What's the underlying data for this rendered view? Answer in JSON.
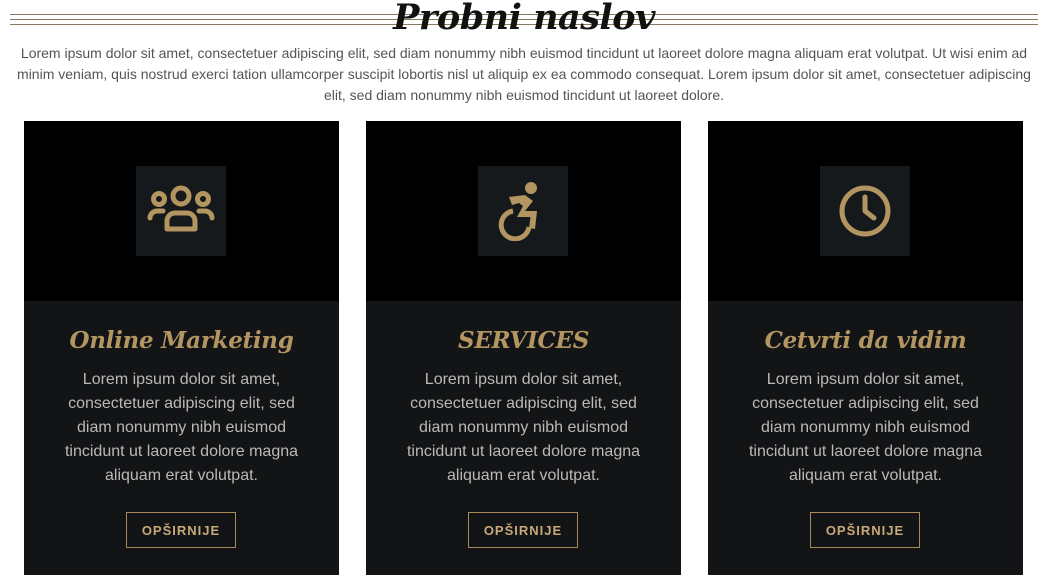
{
  "section": {
    "title": "Probni naslov",
    "intro": "Lorem ipsum dolor sit amet, consectetuer adipiscing elit, sed diam nonummy nibh euismod tincidunt ut laoreet dolore magna aliquam erat volutpat. Ut wisi enim ad minim veniam, quis nostrud exerci tation ullamcorper suscipit lobortis nisl ut aliquip ex ea commodo consequat. Lorem ipsum dolor sit amet, consectetuer adipiscing elit, sed diam nonummy nibh euismod tincidunt ut laoreet dolore."
  },
  "cards": [
    {
      "icon": "users-group-icon",
      "title": "Online Marketing",
      "text": "Lorem ipsum dolor sit amet, consectetuer adipiscing elit, sed diam nonummy nibh euismod tincidunt ut laoreet dolore magna aliquam erat volutpat.",
      "button_label": "OPŠIRNIJE"
    },
    {
      "icon": "accessible-wheelchair-icon",
      "title": "SERVICES",
      "text": "Lorem ipsum dolor sit amet, consectetuer adipiscing elit, sed diam nonummy nibh euismod tincidunt ut laoreet dolore magna aliquam erat volutpat.",
      "button_label": "OPŠIRNIJE"
    },
    {
      "icon": "clock-icon",
      "title": "Cetvrti da vidim",
      "text": "Lorem ipsum dolor sit amet, consectetuer adipiscing elit, sed diam nonummy nibh euismod tincidunt ut laoreet dolore magna aliquam erat volutpat.",
      "button_label": "OPŠIRNIJE"
    }
  ],
  "colors": {
    "accent_gold": "#b39561",
    "card_bottom": "#121416",
    "card_top": "#000000",
    "icon_tile": "#16191b",
    "heading": "#111111",
    "intro_text": "#555555",
    "card_text": "#b9b9b9"
  }
}
